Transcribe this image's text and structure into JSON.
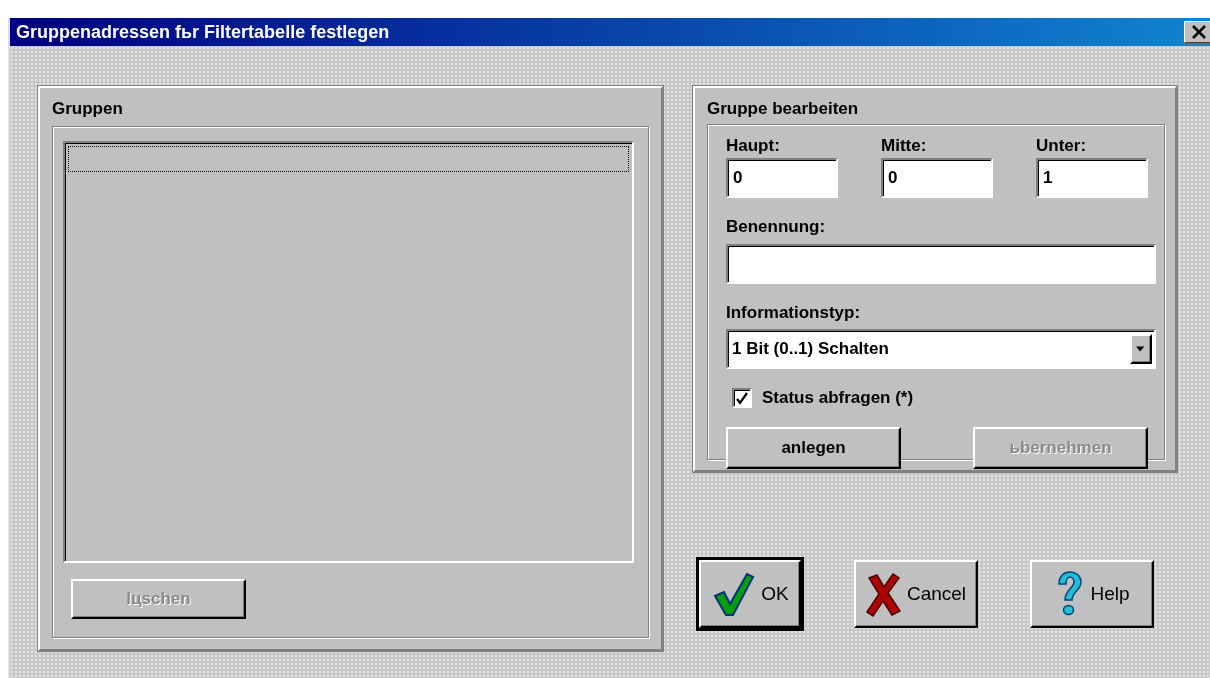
{
  "window": {
    "title": "Gruppenadressen fьr Filtertabelle festlegen"
  },
  "groups_panel": {
    "title": "Gruppen",
    "focus_row": true,
    "delete_button": {
      "label": "lцschen",
      "disabled": true
    }
  },
  "edit_panel": {
    "title": "Gruppe bearbeiten",
    "address_fields": [
      {
        "label": "Haupt:",
        "value": "0"
      },
      {
        "label": "Mitte:",
        "value": "0"
      },
      {
        "label": "Unter:",
        "value": "1"
      }
    ],
    "name_field": {
      "label": "Benennung:"
    },
    "info_type": {
      "label": "Informationstyp:",
      "value": "1 Bit (0..1) Schalten"
    },
    "status_checkbox": {
      "label": "Status abfragen (*)",
      "checked": true
    },
    "buttons": [
      {
        "label": "anlegen",
        "disabled": false
      },
      {
        "label": "ьbernehmen",
        "disabled": true
      }
    ]
  },
  "dialog_buttons": [
    {
      "kind": "ok",
      "label": "OK",
      "default": true
    },
    {
      "kind": "cancel",
      "label": "Cancel",
      "default": false
    },
    {
      "kind": "help",
      "label": "Help",
      "default": false
    }
  ]
}
